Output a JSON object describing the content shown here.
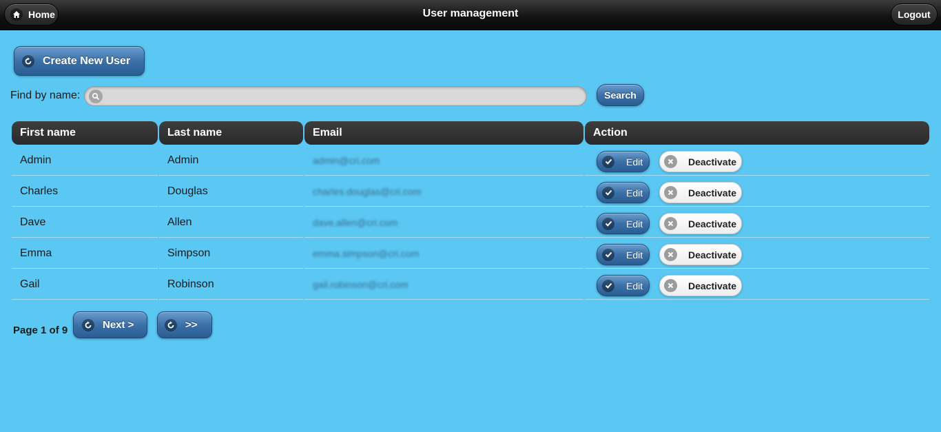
{
  "header": {
    "title": "User management",
    "home_label": "Home",
    "logout_label": "Logout"
  },
  "toolbar": {
    "create_label": "Create New User"
  },
  "search": {
    "label": "Find by name:",
    "value": "",
    "placeholder": "",
    "button_label": "Search"
  },
  "table": {
    "columns": [
      "First name",
      "Last name",
      "Email",
      "Action"
    ],
    "rows": [
      {
        "first": "Admin",
        "last": "Admin",
        "email": "admin@cri.com"
      },
      {
        "first": "Charles",
        "last": "Douglas",
        "email": "charles.douglas@cri.com"
      },
      {
        "first": "Dave",
        "last": "Allen",
        "email": "dave.allen@cri.com"
      },
      {
        "first": "Emma",
        "last": "Simpson",
        "email": "emma.simpson@cri.com"
      },
      {
        "first": "Gail",
        "last": "Robinson",
        "email": "gail.robinson@cri.com"
      }
    ],
    "edit_label": "Edit",
    "deactivate_label": "Deactivate"
  },
  "pagination": {
    "label": "Page 1 of 9",
    "next_label": "Next >",
    "last_label": ">>"
  },
  "colors": {
    "background": "#5bc7f3",
    "header": "#111111",
    "button_blue": "#3b71a8",
    "table_header": "#333333"
  }
}
